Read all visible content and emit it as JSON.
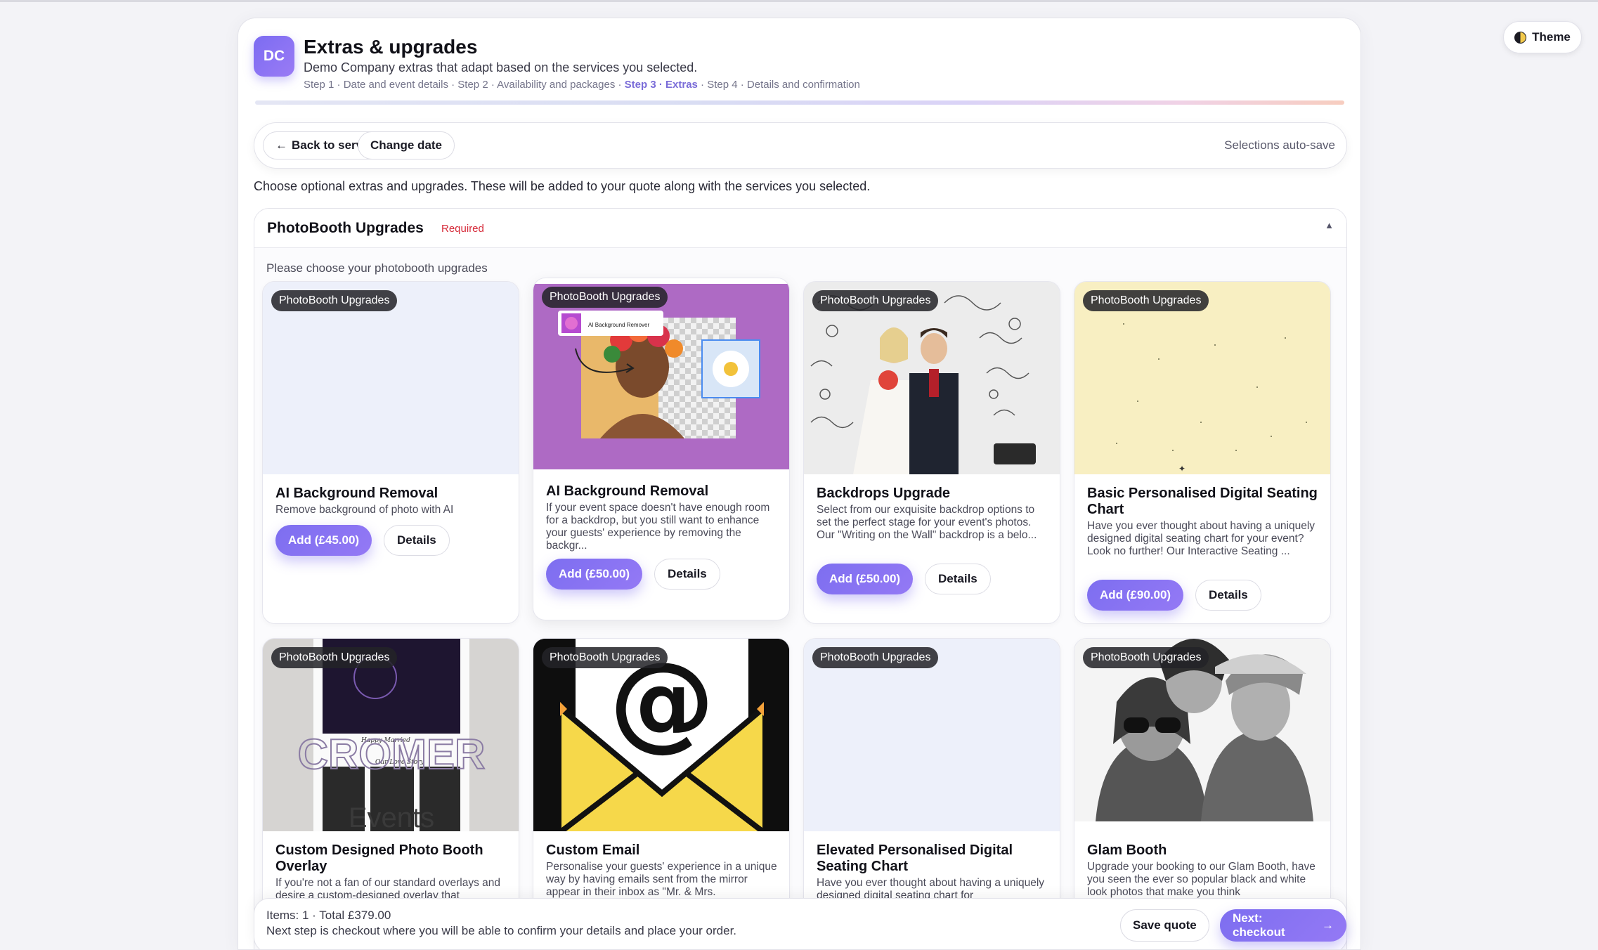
{
  "theme_toggle": {
    "label": "Theme"
  },
  "header": {
    "brand_initials": "DC",
    "title": "Extras & upgrades",
    "subtitle": "Demo Company extras that adapt based on the services you selected.",
    "steps_before": "Step 1 · Date and event details · Step 2 · Availability and packages · ",
    "current_step": "Step 3 · Extras",
    "steps_after": " · Step 4 · Details and confirmation"
  },
  "toolbar": {
    "back_label": "Back to services",
    "change_date_label": "Change date",
    "autosave_text": "Selections auto-save"
  },
  "intro_text": "Choose optional extras and upgrades. These will be added to your quote along with the services you selected.",
  "section": {
    "title": "PhotoBooth Upgrades",
    "required_label": "Required",
    "collapse_symbol": "▲",
    "description": "Please choose your photobooth upgrades",
    "cards": [
      {
        "tag": "PhotoBooth Upgrades",
        "title": "AI Background Removal",
        "description": "Remove background of photo with AI",
        "add_label": "Add (£45.00)",
        "details_label": "Details"
      },
      {
        "tag": "PhotoBooth Upgrades",
        "title": "AI Background Removal",
        "description": "If your event space doesn't have enough room for a backdrop, but you still want to enhance your guests' experience by removing the backgr...",
        "add_label": "Add (£50.00)",
        "details_label": "Details",
        "thumb_caption": "AI Background Remover"
      },
      {
        "tag": "PhotoBooth Upgrades",
        "title": "Backdrops Upgrade",
        "description": "Select from our exquisite backdrop options to set the perfect stage for your event's photos. Our \"Writing on the Wall\" backdrop is a belo...",
        "add_label": "Add (£50.00)",
        "details_label": "Details"
      },
      {
        "tag": "PhotoBooth Upgrades",
        "title": "Basic Personalised Digital Seating Chart",
        "description": "Have you ever thought about having a uniquely designed digital seating chart for your event? Look no further! Our Interactive Seating ...",
        "add_label": "Add (£90.00)",
        "details_label": "Details"
      },
      {
        "tag": "PhotoBooth Upgrades",
        "title": "Custom Designed Photo Booth Overlay",
        "description": "If you're not a fan of our standard overlays and desire a custom-designed overlay that"
      },
      {
        "tag": "PhotoBooth Upgrades",
        "title": "Custom Email",
        "description": "Personalise your guests' experience in a unique way by having emails sent from the mirror appear in their inbox as \"Mr. & Mrs."
      },
      {
        "tag": "PhotoBooth Upgrades",
        "title": "Elevated Personalised Digital Seating Chart",
        "description": "Have you ever thought about having a uniquely designed digital seating chart for"
      },
      {
        "tag": "PhotoBooth Upgrades",
        "title": "Glam Booth",
        "description": "Upgrade your booking to our Glam Booth, have you seen the ever so popular black and white look photos that make you think"
      }
    ]
  },
  "overlay_thumb": {
    "word1": "CROMER",
    "word2": "Events",
    "script1": "Happy Married",
    "script2": "Our Love Story"
  },
  "footer": {
    "summary": "Items: 1 · Total £379.00",
    "note": "Next step is checkout where you will be able to confirm your details and place your order.",
    "save_label": "Save quote",
    "next_label": "Next: checkout"
  },
  "colors": {
    "accent": "#7d6ef0",
    "required": "#d62b3a",
    "tag_bg": "#232328"
  },
  "icons": [
    "theme-half-moon-icon",
    "arrow-left-icon",
    "chevron-up-icon",
    "arrow-right-icon"
  ]
}
